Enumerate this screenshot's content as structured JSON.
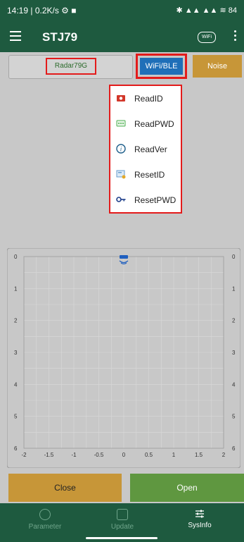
{
  "status_bar": {
    "left": "14:19 | 0.2K/s ⚙ ■",
    "right": "✱ ▲▲ ▲▲ ≋ 84"
  },
  "app_bar": {
    "title": "STJ79",
    "wifi_badge": "WiFi"
  },
  "top_buttons": {
    "radar": "Radar79G",
    "wifi": "WiFi/BLE",
    "noise": "Noise"
  },
  "dropdown": {
    "items": [
      {
        "label": "ReadID",
        "icon": "camera-icon"
      },
      {
        "label": "ReadPWD",
        "icon": "password-dots-icon"
      },
      {
        "label": "ReadVer",
        "icon": "info-icon"
      },
      {
        "label": "ResetID",
        "icon": "reset-card-icon"
      },
      {
        "label": "ResetPWD",
        "icon": "key-icon"
      }
    ]
  },
  "chart_data": {
    "type": "scatter",
    "x_ticks": [
      "-2",
      "-1.5",
      "-1",
      "-0.5",
      "0",
      "0.5",
      "1",
      "1.5",
      "2"
    ],
    "y_ticks": [
      "0",
      "1",
      "2",
      "3",
      "4",
      "5",
      "6"
    ],
    "xlim": [
      -2,
      2
    ],
    "ylim": [
      0,
      6
    ],
    "y_reversed": true,
    "grid": true,
    "sensor_marker_icon": "radar-sensor-icon"
  },
  "bottom_buttons": {
    "close": "Close",
    "open": "Open"
  },
  "bottom_nav": {
    "items": [
      {
        "label": "Parameter",
        "icon": "gear-icon",
        "active": false
      },
      {
        "label": "Update",
        "icon": "update-icon",
        "active": false
      },
      {
        "label": "SysInfo",
        "icon": "sliders-icon",
        "active": true
      }
    ]
  }
}
